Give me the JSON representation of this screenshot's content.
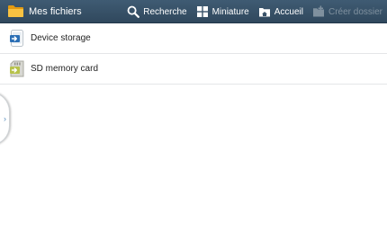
{
  "app": {
    "title": "Mes fichiers",
    "icon": "folder-icon"
  },
  "toolbar": {
    "actions": [
      {
        "label": "Recherche",
        "icon": "search-icon",
        "enabled": true
      },
      {
        "label": "Miniature",
        "icon": "grid-view-icon",
        "enabled": true
      },
      {
        "label": "Accueil",
        "icon": "home-folder-icon",
        "enabled": true
      },
      {
        "label": "Créer dossier",
        "icon": "new-folder-icon",
        "enabled": false
      }
    ]
  },
  "storage_list": {
    "items": [
      {
        "label": "Device storage",
        "icon": "device-storage-icon"
      },
      {
        "label": "SD memory card",
        "icon": "sd-card-icon"
      }
    ]
  },
  "drawer": {
    "handle_glyph": "›"
  },
  "colors": {
    "action_bar": "#3a5369",
    "folder": "#f5b82a",
    "accent_blue": "#2b6fb5",
    "disabled_text": "#7f909e",
    "divider": "#e4e6e8"
  }
}
